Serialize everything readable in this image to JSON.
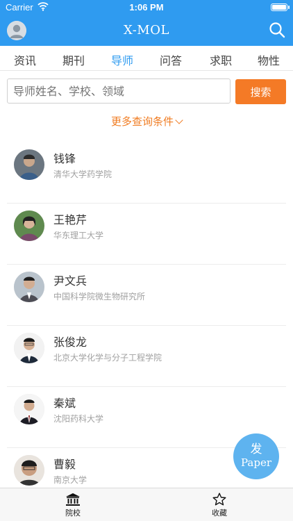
{
  "status_bar": {
    "carrier": "Carrier",
    "time": "1:06 PM"
  },
  "header": {
    "title": "X-MOL",
    "avatar_icon": "user-avatar-icon",
    "search_icon": "search-icon"
  },
  "tabs": [
    {
      "label": "资讯",
      "active": false
    },
    {
      "label": "期刊",
      "active": false
    },
    {
      "label": "导师",
      "active": true
    },
    {
      "label": "问答",
      "active": false
    },
    {
      "label": "求职",
      "active": false
    },
    {
      "label": "物性",
      "active": false
    }
  ],
  "search": {
    "placeholder": "导师姓名、学校、领域",
    "button_label": "搜索"
  },
  "more_conditions_label": "更多查询条件",
  "advisors": [
    {
      "name": "钱锋",
      "affiliation": "清华大学药学院"
    },
    {
      "name": "王艳芹",
      "affiliation": "华东理工大学"
    },
    {
      "name": "尹文兵",
      "affiliation": "中国科学院微生物研究所"
    },
    {
      "name": "张俊龙",
      "affiliation": "北京大学化学与分子工程学院"
    },
    {
      "name": "秦斌",
      "affiliation": "沈阳药科大学"
    },
    {
      "name": "曹毅",
      "affiliation": "南京大学"
    }
  ],
  "fab": {
    "line1": "发",
    "line2": "Paper"
  },
  "tabbar": [
    {
      "label": "院校",
      "icon": "institution-icon"
    },
    {
      "label": "收藏",
      "icon": "star-icon"
    }
  ],
  "colors": {
    "primary": "#2f9bf0",
    "accent": "#f47a26",
    "fab": "#5eb3ef"
  }
}
